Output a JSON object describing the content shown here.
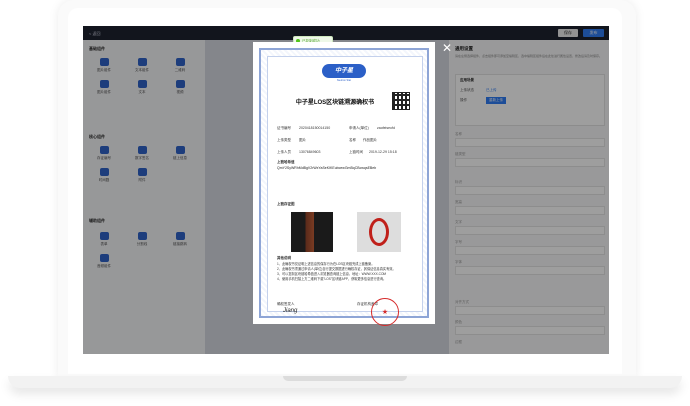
{
  "topbar": {
    "back_label": "< 返回",
    "save_label": "保存",
    "publish_label": "发布"
  },
  "left_panel": {
    "sections": [
      {
        "title": "基础组件",
        "tools": [
          "图片组件",
          "文本组件",
          "二维码",
          "图片组件",
          "文本",
          "视频"
        ]
      },
      {
        "title": "核心组件",
        "tools": [
          "存证编号",
          "数字签名",
          "链上信息",
          "时间戳",
          "附件"
        ]
      },
      {
        "title": "辅助组件",
        "tools": [
          "表单",
          "分割线",
          "链接跳转",
          "音频组件"
        ]
      }
    ]
  },
  "right_panel": {
    "title": "通用设置",
    "desc": "请在左侧选择组件，点击组件即可添加至编辑区，选中编辑区组件后在此处进行属性设置，修改后请及时保存。",
    "box_title": "应用场景",
    "row1_label": "上传状态",
    "row1_value": "已上传",
    "row2_label": "操作",
    "row2_button": "重新上传",
    "labels": [
      "名称",
      "链类型",
      "标识",
      "宽高",
      "文字",
      "字号",
      "字体",
      "对齐方式",
      "颜色",
      "边框"
    ]
  },
  "modal": {
    "toast": "已复制成功",
    "close_symbol": "✕",
    "logo_text": "中子星",
    "logo_sub": "Neutron Star",
    "title": "中子星LOS区块链溯源确权书",
    "fields": {
      "cert_no_label": "证书编号",
      "cert_no": "2020418150014150",
      "applicant_label": "申请人(单位)",
      "applicant": "zaofeiseofd",
      "type_label": "上传类型",
      "type": "图片",
      "name_label": "名称",
      "name": "作品图片",
      "uploader_label": "上传人员",
      "uploader": "13076849603",
      "time_label": "上链时间",
      "time": "2019-12-29 15:18",
      "hash_label": "上链哈希值",
      "hash": "QmY2SyWRhMdBgV2rWxYaSeKIKEubcewGmBqCBcwqsEBeb",
      "image_label": "上链存证图"
    },
    "notes_title": "其他说明",
    "notes": [
      "1、此确权书仅证明上述信息的保存行为在LOS区块链完成上链备案。",
      "2、此确权书须通过申请人(单位)自行提交数据进行确权存证，其保证信息真实有效。",
      "3、可以复制区块链哈希值进入浏览器查询链上信息，地址：WWW.XXX.COM",
      "4、使用手机扫描上方二维码下载\"LOS\"区块链APP，获取更多信息进行查询。"
    ],
    "signer_label": "确权签发人",
    "signature": "Jiang",
    "org_label": "存证机构盖章",
    "stamp_text": "★"
  },
  "colors": {
    "accent": "#2f7cf6",
    "stamp": "#d62b2b",
    "toast": "#52c41a"
  }
}
